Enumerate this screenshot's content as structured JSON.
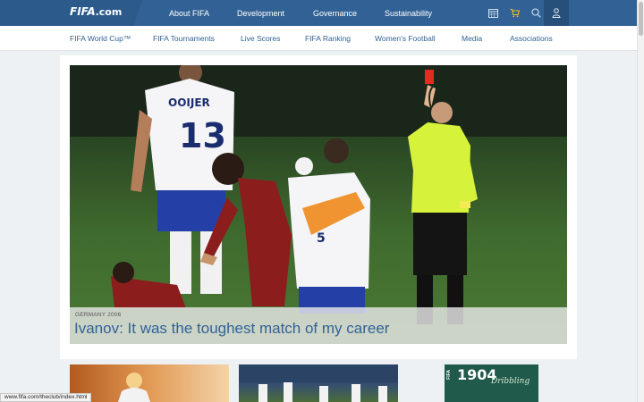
{
  "header": {
    "logo_text": "FIFA",
    "logo_domain": ".com",
    "nav": [
      "About FIFA",
      "Development",
      "Governance",
      "Sustainability"
    ],
    "icons": [
      "calendar-icon",
      "cart-icon",
      "search-icon",
      "user-icon"
    ],
    "brand_color": "#326295",
    "cart_color": "#f0c419"
  },
  "subnav": {
    "items": [
      "FIFA World Cup™",
      "FIFA Tournaments",
      "Live Scores",
      "FIFA Ranking",
      "Women's Football",
      "Media",
      "Associations"
    ]
  },
  "hero": {
    "kicker": "GERMANY 2006",
    "headline": "Ivanov: It was the toughest match of my career",
    "player_name": "OOIJER",
    "player_number": "13"
  },
  "thumbnails": {
    "third_number": "1904",
    "third_logo": "FIFA",
    "third_script": "Dribbling"
  },
  "status_bar": {
    "url": "www.fifa.com/theclub/index.html"
  }
}
